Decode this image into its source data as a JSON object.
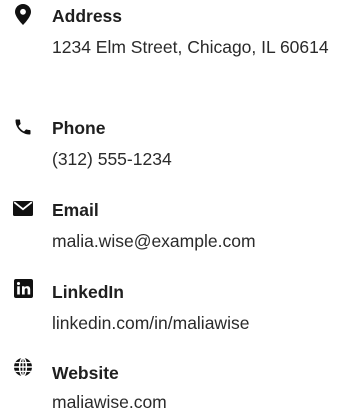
{
  "contacts": [
    {
      "label": "Address",
      "value": "1234 Elm Street, Chicago, IL 60614",
      "icon": "map-marker-icon"
    },
    {
      "label": "Phone",
      "value": "(312) 555-1234",
      "icon": "phone-icon"
    },
    {
      "label": "Email",
      "value": "malia.wise@example.com",
      "icon": "envelope-icon"
    },
    {
      "label": "LinkedIn",
      "value": "linkedin.com/in/maliawise",
      "icon": "linkedin-icon"
    },
    {
      "label": "Website",
      "value": "maliawise.com",
      "icon": "globe-icon"
    }
  ],
  "colors": {
    "icon": "#111111",
    "label": "#1f1f1f",
    "value": "#2a2a2a",
    "background": "#ffffff"
  }
}
